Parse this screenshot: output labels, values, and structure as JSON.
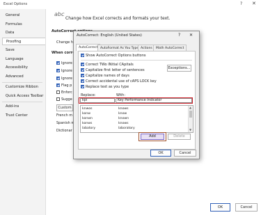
{
  "window": {
    "title": "Excel Options",
    "help": "?",
    "close": "✕"
  },
  "sidebar": {
    "items": [
      {
        "label": "General"
      },
      {
        "label": "Formulas"
      },
      {
        "label": "Data"
      },
      {
        "label": "Proofing"
      },
      {
        "label": "Save"
      },
      {
        "label": "Language"
      },
      {
        "label": "Accessibility"
      },
      {
        "label": "Advanced"
      },
      {
        "label": "Customize Ribbon"
      },
      {
        "label": "Quick Access Toolbar"
      },
      {
        "label": "Add-ins"
      },
      {
        "label": "Trust Center"
      }
    ]
  },
  "main": {
    "abc": "abc",
    "header": "Change how Excel corrects and formats your text.",
    "autocorrect_title": "AutoCorrect options",
    "change_how": "Change h",
    "when_correcting": "When correc",
    "bg_options": [
      "Ignore",
      "Ignore",
      "Ignore",
      "Flag p",
      "Enforc",
      "Sugge"
    ],
    "custom_btn": "Custom",
    "french_modes": "French m",
    "spanish_modes": "Spanish m",
    "dictionary": "Dictionar",
    "ok": "OK",
    "cancel": "Cancel"
  },
  "dialog": {
    "title": "AutoCorrect: English (United States)",
    "help": "?",
    "close": "✕",
    "tabs": [
      "AutoCorrect",
      "AutoFormat As You Type",
      "Actions",
      "Math AutoCorrect"
    ],
    "show_buttons": "Show AutoCorrect Options buttons",
    "options": [
      "Correct TWo INitial CApitals",
      "Capitalize first letter of sentences",
      "Capitalize names of days",
      "Correct accidental use of cAPS LOCK key",
      "Replace text as you type"
    ],
    "exceptions": "Exceptions...",
    "replace_label": "Replace:",
    "with_label": "With:",
    "replace_value": "kpi",
    "with_value": "Key Performance Indicator",
    "rows": [
      {
        "replace": "knwos",
        "with": "knows"
      },
      {
        "replace": "konw",
        "with": "know"
      },
      {
        "replace": "konwn",
        "with": "known"
      },
      {
        "replace": "konws",
        "with": "knows"
      },
      {
        "replace": "labatory",
        "with": "laboratory"
      }
    ],
    "add": "Add",
    "delete": "Delete",
    "ok": "OK",
    "cancel": "Cancel"
  },
  "colors": {
    "accent": "#2f5fb6",
    "highlight": "#d0202a",
    "add_highlight": "#a0522d"
  }
}
